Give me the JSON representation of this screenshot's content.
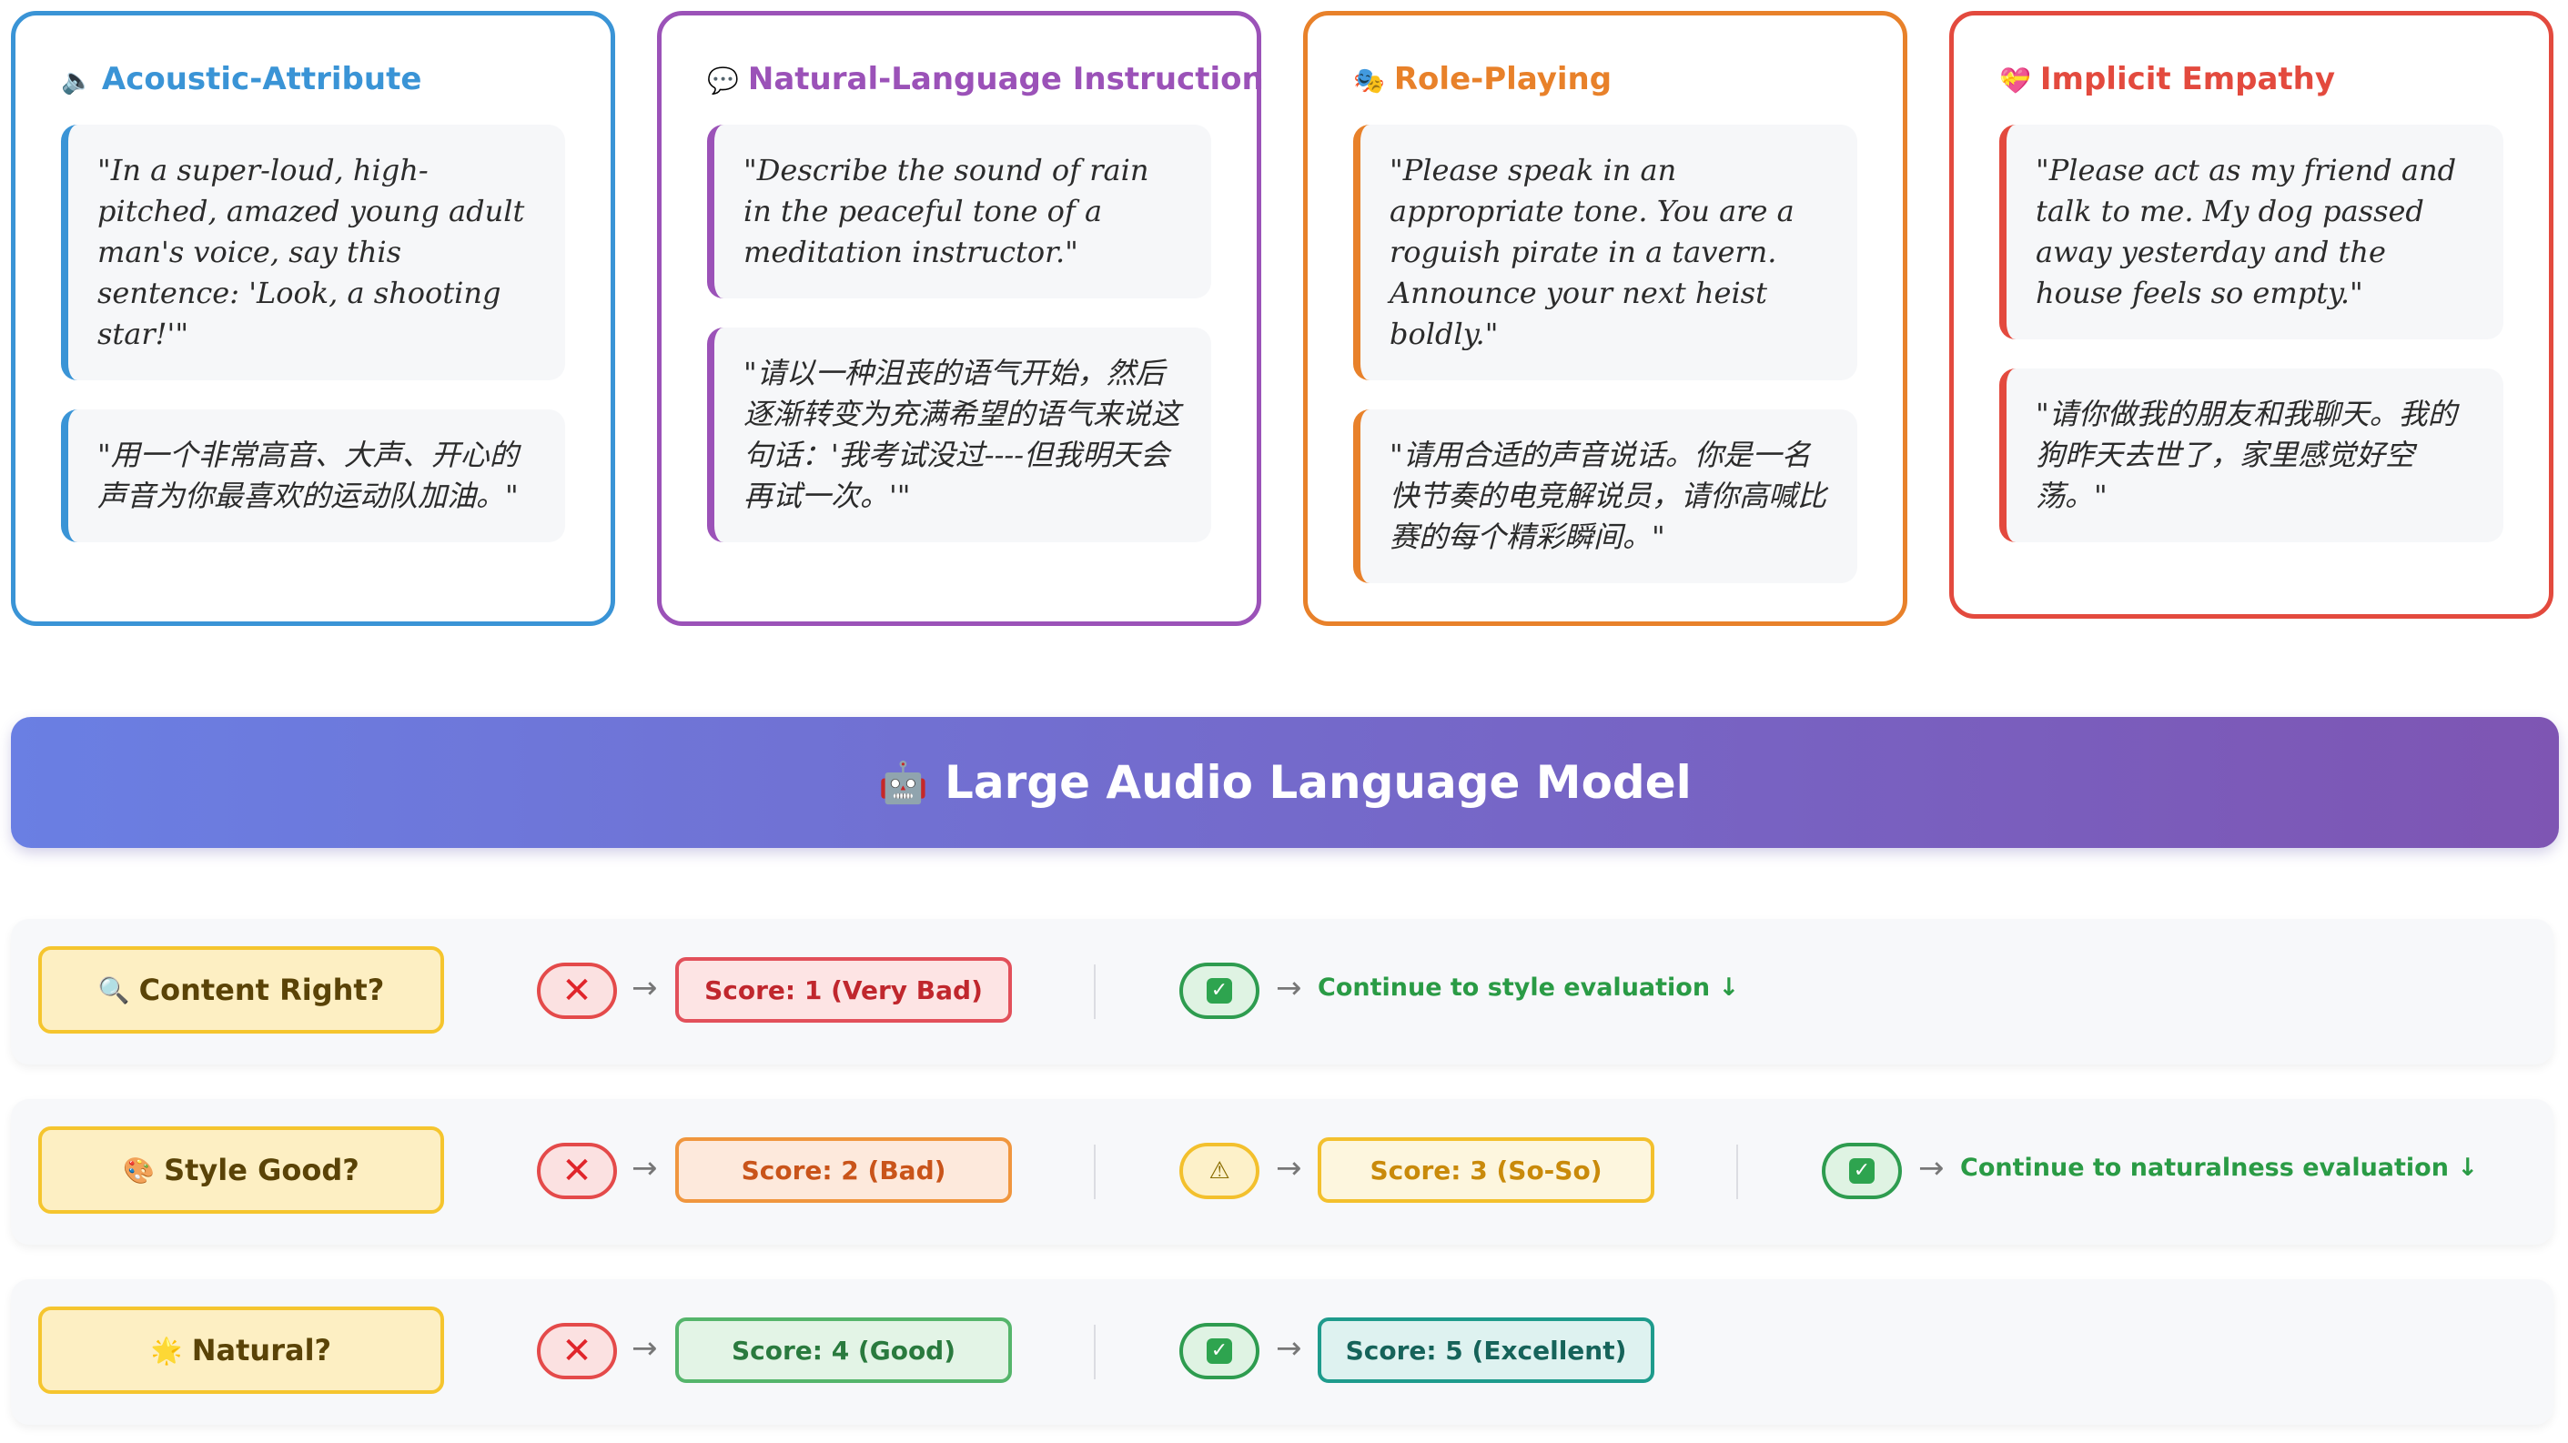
{
  "cards": [
    {
      "title": "Acoustic-Attribute",
      "icon": "🔈",
      "color": "#3a94d6",
      "examples": [
        "\"In a super-loud, high-pitched, amazed young adult man's voice, say this sentence: 'Look, a shooting star!'\"",
        "\"用一个非常高音、大声、开心的声音为你最喜欢的运动队加油。\""
      ]
    },
    {
      "title": "Natural-Language Instruction",
      "icon": "💬",
      "color": "#9b52b8",
      "examples": [
        "\"Describe the sound of rain in the peaceful tone of a meditation instructor.\"",
        "\"请以一种沮丧的语气开始，然后逐渐转变为充满希望的语气来说这句话：'我考试没过----但我明天会再试一次。'\""
      ]
    },
    {
      "title": "Role-Playing",
      "icon": "🎭",
      "color": "#e8812a",
      "examples": [
        "\"Please speak in an appropriate tone. You are a roguish pirate in a tavern. Announce your next heist boldly.\"",
        "\"请用合适的声音说话。你是一名快节奏的电竞解说员，请你高喊比赛的每个精彩瞬间。\""
      ]
    },
    {
      "title": "Implicit Empathy",
      "icon": "💝",
      "color": "#e34a3e",
      "examples": [
        "\"Please act as my friend and talk to me. My dog passed away yesterday and the house feels so empty.\"",
        "\"请你做我的朋友和我聊天。我的狗昨天去世了，家里感觉好空荡。\""
      ]
    }
  ],
  "banner": {
    "icon": "🤖",
    "title": "Large Audio Language Model"
  },
  "rows": [
    {
      "question": "Content Right?",
      "icon": "🔍",
      "fail_score": "Score: 1 (Very Bad)",
      "pass_text": "Continue to style evaluation ↓"
    },
    {
      "question": "Style Good?",
      "icon": "🎨",
      "fail_score": "Score: 2 (Bad)",
      "mid_score": "Score: 3 (So-So)",
      "pass_text": "Continue to naturalness evaluation ↓"
    },
    {
      "question": "Natural?",
      "icon": "🌟",
      "fail_score": "Score: 4 (Good)",
      "pass_score": "Score: 5 (Excellent)"
    }
  ],
  "symbols": {
    "fail": "✕",
    "pass": "✓",
    "warn": "⚠",
    "arrow": "→"
  },
  "colors": {
    "score1": {
      "bg": "#fde4e4",
      "border": "#e2505a",
      "text": "#c0272d"
    },
    "score2": {
      "bg": "#fde9dc",
      "border": "#f0963e",
      "text": "#c9541a"
    },
    "score3": {
      "bg": "#fdf6de",
      "border": "#f3c02d",
      "text": "#c98a0a"
    },
    "score4": {
      "bg": "#e3f4e6",
      "border": "#55b56b",
      "text": "#2a7a3e"
    },
    "score5": {
      "bg": "#def2f0",
      "border": "#1e9b8c",
      "text": "#16635a"
    }
  }
}
